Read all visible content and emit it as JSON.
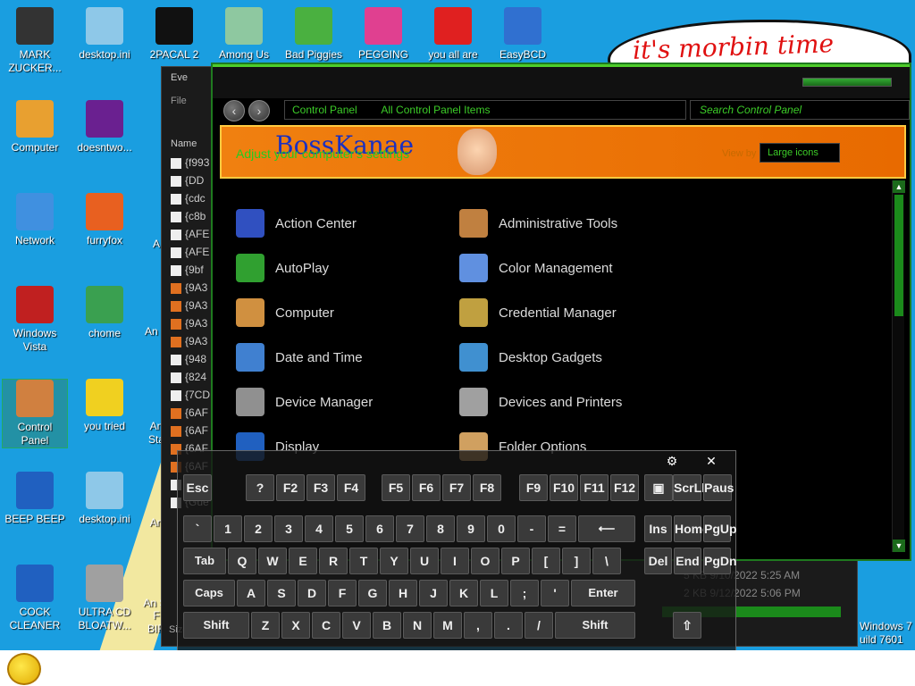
{
  "desktop": {
    "speech_text": "it's morbin time",
    "icons": [
      {
        "label": "MARK ZUCKER...",
        "color": "#333333"
      },
      {
        "label": "desktop.ini",
        "color": "#8ec8e8"
      },
      {
        "label": "2PACAL 2",
        "color": "#111111"
      },
      {
        "label": "Among Us",
        "color": "#8ec8a0"
      },
      {
        "label": "Bad Piggies",
        "color": "#4ab040"
      },
      {
        "label": "PEGGING",
        "color": "#e04090"
      },
      {
        "label": "you all are",
        "color": "#e02020"
      },
      {
        "label": "EasyBCD",
        "color": "#3070d0"
      },
      {
        "label": "Computer",
        "color": "#e8a030"
      },
      {
        "label": "doesntwo...",
        "color": "#6a2090"
      },
      {
        "label": "Network",
        "color": "#4090e0"
      },
      {
        "label": "furryfox",
        "color": "#e86020"
      },
      {
        "label": "Windows Vista",
        "color": "#c02020"
      },
      {
        "label": "chome",
        "color": "#3aa050"
      },
      {
        "label": "Control Panel",
        "color": "#d08040"
      },
      {
        "label": "you tried",
        "color": "#f0d020"
      },
      {
        "label": "BEEP BEEP",
        "color": "#2060c0"
      },
      {
        "label": "desktop.ini",
        "color": "#8ec8e8"
      },
      {
        "label": "COCK CLEANER",
        "color": "#2060c0"
      },
      {
        "label": "ULTRA CD BLOATW...",
        "color": "#a0a0a0"
      }
    ],
    "partial_labels": [
      "A",
      "An S",
      "An",
      "An Sta",
      "An St",
      "F BIR"
    ],
    "watermark": [
      "Windows 7",
      "uild 7601"
    ]
  },
  "everything": {
    "title": "Eve",
    "menu": "File",
    "column": "Name",
    "rows": [
      "{f993",
      "{DD",
      "{cdc",
      "{c8b",
      "{AFE",
      "{AFE",
      "{9bf",
      "{9A3",
      "{9A3",
      "{9A3",
      "{9A3",
      "{948",
      "{824",
      "{7CD",
      "{6AF",
      "{6AF",
      "{6AF",
      "{6AF",
      "{Gro",
      "{Gue"
    ],
    "details": [
      "5 KB  9/10/2022 5:25 AM",
      "2 KB  9/12/2022 5:06 PM"
    ],
    "status": "Size"
  },
  "control_panel": {
    "breadcrumb": [
      "Control Panel",
      "All Control Panel Items"
    ],
    "search_placeholder": "Search Control Panel",
    "banner_title": "BossKanae",
    "banner_subtitle": "Adjust your computer's settings",
    "view_by_label": "View by",
    "view_by_value": "Large icons",
    "items_left": [
      {
        "label": "Action Center",
        "color": "#3050c0"
      },
      {
        "label": "AutoPlay",
        "color": "#30a030"
      },
      {
        "label": "Computer",
        "color": "#d09040"
      },
      {
        "label": "Date and Time",
        "color": "#4080d0"
      },
      {
        "label": "Device Manager",
        "color": "#909090"
      },
      {
        "label": "Display",
        "color": "#2060c0"
      }
    ],
    "items_right": [
      {
        "label": "Administrative Tools",
        "color": "#c08040"
      },
      {
        "label": "Color Management",
        "color": "#6090e0"
      },
      {
        "label": "Credential Manager",
        "color": "#c0a040"
      },
      {
        "label": "Desktop Gadgets",
        "color": "#4090d0"
      },
      {
        "label": "Devices and Printers",
        "color": "#a0a0a0"
      },
      {
        "label": "Folder Options",
        "color": "#d0a060"
      }
    ]
  },
  "osk": {
    "settings_icon": "gear-icon",
    "close_label": "✕",
    "keys_row0": [
      "Esc",
      "?",
      "F2",
      "F3",
      "F4",
      "F5",
      "F6",
      "F7",
      "F8",
      "F9",
      "F10",
      "F11",
      "F12",
      "▣",
      "ScrLk",
      "Paus"
    ],
    "keys_row1": [
      "`",
      "1",
      "2",
      "3",
      "4",
      "5",
      "6",
      "7",
      "8",
      "9",
      "0",
      "-",
      "=",
      "⟵",
      "Ins",
      "Home",
      "PgUp"
    ],
    "keys_row2": [
      "Tab",
      "Q",
      "W",
      "E",
      "R",
      "T",
      "Y",
      "U",
      "I",
      "O",
      "P",
      "[",
      "]",
      "\\",
      "Del",
      "End",
      "PgDn"
    ],
    "keys_row3": [
      "Caps",
      "A",
      "S",
      "D",
      "F",
      "G",
      "H",
      "J",
      "K",
      "L",
      ";",
      "'",
      "Enter"
    ],
    "keys_row4": [
      "Shift",
      "Z",
      "X",
      "C",
      "V",
      "B",
      "N",
      "M",
      ",",
      ".",
      "/",
      "Shift",
      "⇧"
    ]
  }
}
